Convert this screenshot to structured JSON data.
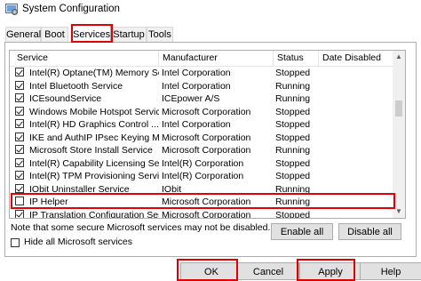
{
  "window": {
    "title": "System Configuration",
    "icon": "msconfig-icon"
  },
  "tabs": [
    {
      "label": "General"
    },
    {
      "label": "Boot"
    },
    {
      "label": "Services",
      "active": true
    },
    {
      "label": "Startup"
    },
    {
      "label": "Tools"
    }
  ],
  "columns": {
    "service": "Service",
    "manufacturer": "Manufacturer",
    "status": "Status",
    "date_disabled": "Date Disabled"
  },
  "services": [
    {
      "name": "Intel(R) Optane(TM) Memory Se...",
      "manufacturer": "Intel Corporation",
      "status": "Stopped",
      "date_disabled": "",
      "checked": true
    },
    {
      "name": "Intel Bluetooth Service",
      "manufacturer": "Intel Corporation",
      "status": "Running",
      "date_disabled": "",
      "checked": true
    },
    {
      "name": "ICEsoundService",
      "manufacturer": "ICEpower A/S",
      "status": "Running",
      "date_disabled": "",
      "checked": true
    },
    {
      "name": "Windows Mobile Hotspot Service",
      "manufacturer": "Microsoft Corporation",
      "status": "Stopped",
      "date_disabled": "",
      "checked": true
    },
    {
      "name": "Intel(R) HD Graphics Control ...",
      "manufacturer": "Intel Corporation",
      "status": "Stopped",
      "date_disabled": "",
      "checked": true
    },
    {
      "name": "IKE and AuthIP IPsec Keying M...",
      "manufacturer": "Microsoft Corporation",
      "status": "Stopped",
      "date_disabled": "",
      "checked": true
    },
    {
      "name": "Microsoft Store Install Service",
      "manufacturer": "Microsoft Corporation",
      "status": "Running",
      "date_disabled": "",
      "checked": true
    },
    {
      "name": "Intel(R) Capability Licensing Ser...",
      "manufacturer": "Intel(R) Corporation",
      "status": "Stopped",
      "date_disabled": "",
      "checked": true
    },
    {
      "name": "Intel(R) TPM Provisioning Service",
      "manufacturer": "Intel(R) Corporation",
      "status": "Stopped",
      "date_disabled": "",
      "checked": true
    },
    {
      "name": "IObit Uninstaller Service",
      "manufacturer": "IObit",
      "status": "Running",
      "date_disabled": "",
      "checked": true
    },
    {
      "name": "IP Helper",
      "manufacturer": "Microsoft Corporation",
      "status": "Running",
      "date_disabled": "",
      "checked": false
    },
    {
      "name": "IP Translation Configuration Ser...",
      "manufacturer": "Microsoft Corporation",
      "status": "Stopped",
      "date_disabled": "",
      "checked": true
    }
  ],
  "note": "Note that some secure Microsoft services may not be disabled.",
  "hide_ms_label": "Hide all Microsoft services",
  "hide_ms_checked": false,
  "enable_all_label": "Enable all",
  "disable_all_label": "Disable all",
  "footer": {
    "ok": "OK",
    "cancel": "Cancel",
    "apply": "Apply",
    "help": "Help"
  },
  "colors": {
    "highlight_frame": "#e00000",
    "button_face": "#e1e1e1"
  }
}
